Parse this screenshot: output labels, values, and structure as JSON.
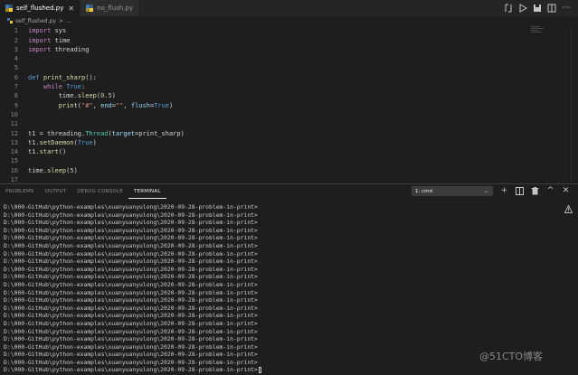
{
  "tabs": [
    {
      "label": "self_flushed.py",
      "active": true
    },
    {
      "label": "no_flush.py",
      "active": false
    }
  ],
  "breadcrumb": {
    "file": "self_flushed.py",
    "separator": ">",
    "rest": "..."
  },
  "code_lines": [
    {
      "n": "1",
      "html": "<span class=\"kw-purple\">import</span> sys"
    },
    {
      "n": "2",
      "html": "<span class=\"kw-purple\">import</span> time"
    },
    {
      "n": "3",
      "html": "<span class=\"kw-purple\">import</span> threading"
    },
    {
      "n": "4",
      "html": ""
    },
    {
      "n": "5",
      "html": ""
    },
    {
      "n": "6",
      "html": "<span class=\"kw-blue\">def</span> <span class=\"fn\">print_sharp</span>():"
    },
    {
      "n": "7",
      "html": "    <span class=\"kw-purple\">while</span> <span class=\"kw-blue\">True</span>:"
    },
    {
      "n": "8",
      "html": "        time.<span class=\"fn\">sleep</span>(<span class=\"num\">0.5</span>)"
    },
    {
      "n": "9",
      "html": "        <span class=\"fn\">print</span>(<span class=\"str\">\"#\"</span>, <span class=\"par\">end</span>=<span class=\"str\">\"\"</span>, <span class=\"par\">flush</span>=<span class=\"kw-blue\">True</span>)"
    },
    {
      "n": "10",
      "html": ""
    },
    {
      "n": "11",
      "html": ""
    },
    {
      "n": "12",
      "html": "t1 = threading.<span class=\"cls\">Thread</span>(<span class=\"par\">target</span>=print_sharp)"
    },
    {
      "n": "13",
      "html": "t1.<span class=\"fn\">setDaemon</span>(<span class=\"kw-blue\">True</span>)"
    },
    {
      "n": "14",
      "html": "t1.<span class=\"fn\">start</span>()"
    },
    {
      "n": "15",
      "html": ""
    },
    {
      "n": "16",
      "html": "time.<span class=\"fn\">sleep</span>(<span class=\"num\">5</span>)"
    },
    {
      "n": "17",
      "html": ""
    }
  ],
  "panel": {
    "tabs": [
      "PROBLEMS",
      "OUTPUT",
      "DEBUG CONSOLE",
      "TERMINAL"
    ],
    "active_tab": "TERMINAL",
    "terminal_select": "1: cmd"
  },
  "terminal": {
    "prompt": "D:\\000-GitHub\\python-examples\\xuanyuanyulong\\2020-09-28-problem-in-print>",
    "line_count": 22
  },
  "watermark": "@51CTO博客",
  "colors": {
    "accent": "#007acc",
    "background": "#1e1e1e"
  },
  "icons": [
    "python-file-icon",
    "close-icon",
    "compare-icon",
    "run-icon",
    "save-icon",
    "split-editor-icon",
    "more-icon",
    "add-terminal-icon",
    "split-terminal-icon",
    "trash-icon",
    "maximize-icon",
    "close-panel-icon",
    "warning-icon"
  ]
}
